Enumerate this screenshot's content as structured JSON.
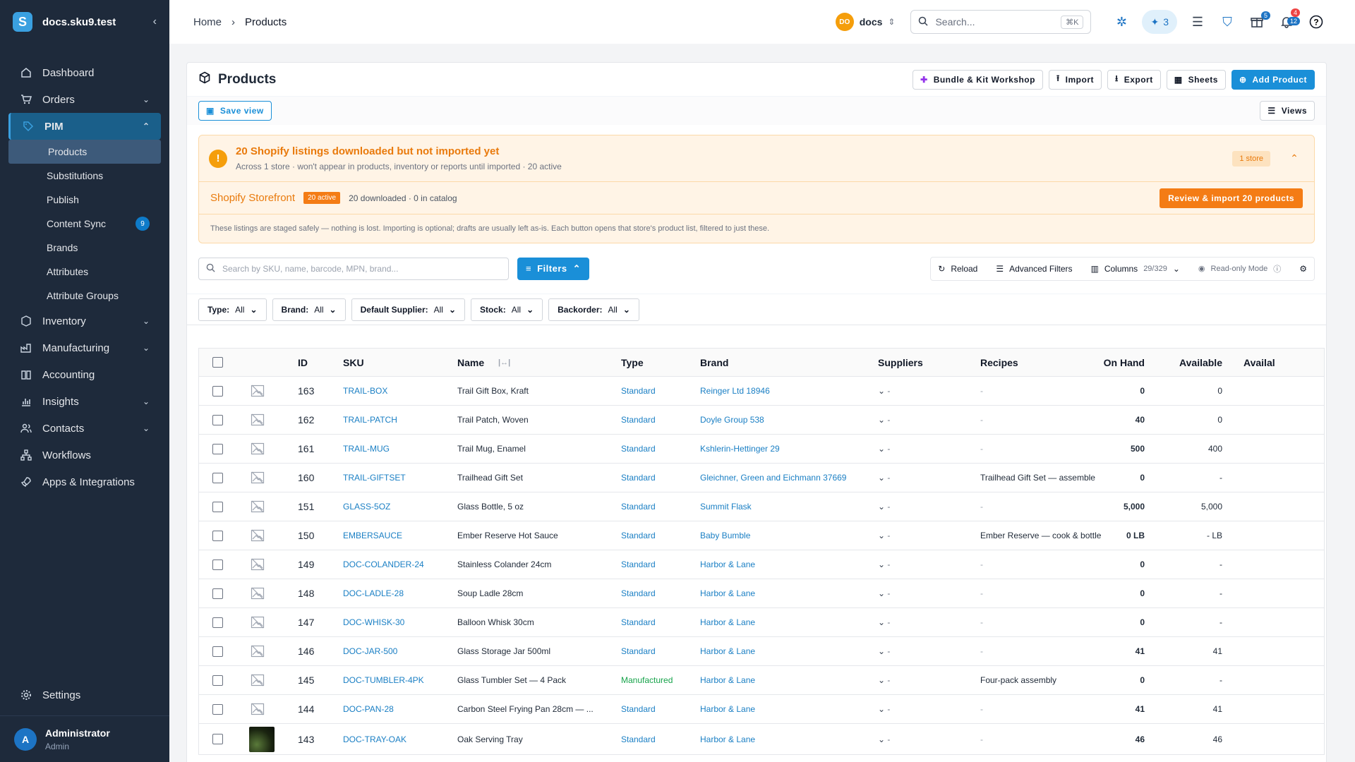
{
  "sidebar": {
    "org": "docs.sku9.test",
    "collapse_icon": "chevron-left",
    "items": [
      {
        "label": "Dashboard",
        "icon": "home-icon"
      },
      {
        "label": "Orders",
        "icon": "cart-icon"
      },
      {
        "label": "PIM",
        "icon": "tag-icon"
      },
      {
        "label": "Inventory",
        "icon": "box-icon"
      },
      {
        "label": "Manufacturing",
        "icon": "factory-icon"
      },
      {
        "label": "Accounting",
        "icon": "book-icon"
      },
      {
        "label": "Insights",
        "icon": "chart-icon"
      },
      {
        "label": "Contacts",
        "icon": "users-icon"
      },
      {
        "label": "Workflows",
        "icon": "workflow-icon"
      },
      {
        "label": "Apps & Integrations",
        "icon": "rocket-icon"
      }
    ],
    "pim_sub": [
      {
        "label": "Products"
      },
      {
        "label": "Substitutions"
      },
      {
        "label": "Publish"
      },
      {
        "label": "Content Sync",
        "badge": "9"
      },
      {
        "label": "Brands"
      },
      {
        "label": "Attributes"
      },
      {
        "label": "Attribute Groups"
      }
    ],
    "settings": "Settings",
    "user": {
      "initial": "A",
      "name": "Administrator",
      "role": "Admin"
    }
  },
  "topbar": {
    "breadcrumb": [
      "Home",
      "Products"
    ],
    "workspace": {
      "badge": "DO",
      "name": "docs"
    },
    "search_placeholder": "Search...",
    "search_kbd": "⌘K",
    "ai_count": "3",
    "gift_badge": "5",
    "bell_badge_top": "4",
    "bell_badge_bottom": "12"
  },
  "page": {
    "title": "Products",
    "actions": {
      "bundle": "Bundle & Kit Workshop",
      "import": "Import",
      "export": "Export",
      "sheets": "Sheets",
      "add": "Add Product"
    },
    "save_view": "Save view",
    "views": "Views"
  },
  "banner": {
    "title": "20 Shopify listings downloaded but not imported yet",
    "subtitle": "Across 1 store · won't appear in products, inventory or reports until imported · 20 active",
    "store_count": "1 store",
    "store_name": "Shopify Storefront",
    "active_tag": "20 active",
    "downloaded": "20 downloaded · 0 in catalog",
    "review_button": "Review & import 20 products",
    "note": "These listings are staged safely — nothing is lost. Importing is optional; drafts are usually left as-is. Each button opens that store's product list, filtered to just these."
  },
  "toolbar": {
    "search_placeholder": "Search by SKU, name, barcode, MPN, brand...",
    "filters": "Filters",
    "reload": "Reload",
    "advanced": "Advanced Filters",
    "columns": "Columns",
    "columns_count": "29/329",
    "readonly": "Read-only Mode"
  },
  "chips": [
    {
      "label": "Type:",
      "value": "All"
    },
    {
      "label": "Brand:",
      "value": "All"
    },
    {
      "label": "Default Supplier:",
      "value": "All"
    },
    {
      "label": "Stock:",
      "value": "All"
    },
    {
      "label": "Backorder:",
      "value": "All"
    }
  ],
  "table": {
    "headers": {
      "id": "ID",
      "sku": "SKU",
      "name": "Name",
      "type": "Type",
      "brand": "Brand",
      "suppliers": "Suppliers",
      "recipes": "Recipes",
      "on_hand": "On Hand",
      "available": "Available",
      "avail2": "Availal"
    },
    "rows": [
      {
        "id": "163",
        "sku": "TRAIL-BOX",
        "name": "Trail Gift Box, Kraft",
        "type": "Standard",
        "brand": "Reinger Ltd 18946",
        "sup": "-",
        "recipe": "-",
        "on_hand": "0",
        "available": "0",
        "img": false
      },
      {
        "id": "162",
        "sku": "TRAIL-PATCH",
        "name": "Trail Patch, Woven",
        "type": "Standard",
        "brand": "Doyle Group 538",
        "sup": "-",
        "recipe": "-",
        "on_hand": "40",
        "available": "0",
        "img": false
      },
      {
        "id": "161",
        "sku": "TRAIL-MUG",
        "name": "Trail Mug, Enamel",
        "type": "Standard",
        "brand": "Kshlerin-Hettinger 29",
        "sup": "-",
        "recipe": "-",
        "on_hand": "500",
        "available": "400",
        "img": false
      },
      {
        "id": "160",
        "sku": "TRAIL-GIFTSET",
        "name": "Trailhead Gift Set",
        "type": "Standard",
        "brand": "Gleichner, Green and Eichmann 37669",
        "sup": "-",
        "recipe": "Trailhead Gift Set — assemble",
        "on_hand": "0",
        "available": "-",
        "img": false
      },
      {
        "id": "151",
        "sku": "GLASS-5OZ",
        "name": "Glass Bottle, 5 oz",
        "type": "Standard",
        "brand": "Summit Flask",
        "sup": "-",
        "recipe": "-",
        "on_hand": "5,000",
        "available": "5,000",
        "img": false
      },
      {
        "id": "150",
        "sku": "EMBERSAUCE",
        "name": "Ember Reserve Hot Sauce",
        "type": "Standard",
        "brand": "Baby Bumble",
        "sup": "-",
        "recipe": "Ember Reserve — cook & bottle",
        "on_hand": "0 LB",
        "available": "- LB",
        "img": false
      },
      {
        "id": "149",
        "sku": "DOC-COLANDER-24",
        "name": "Stainless Colander 24cm",
        "type": "Standard",
        "brand": "Harbor & Lane",
        "sup": "-",
        "recipe": "-",
        "on_hand": "0",
        "available": "-",
        "img": false
      },
      {
        "id": "148",
        "sku": "DOC-LADLE-28",
        "name": "Soup Ladle 28cm",
        "type": "Standard",
        "brand": "Harbor & Lane",
        "sup": "-",
        "recipe": "-",
        "on_hand": "0",
        "available": "-",
        "img": false
      },
      {
        "id": "147",
        "sku": "DOC-WHISK-30",
        "name": "Balloon Whisk 30cm",
        "type": "Standard",
        "brand": "Harbor & Lane",
        "sup": "-",
        "recipe": "-",
        "on_hand": "0",
        "available": "-",
        "img": false
      },
      {
        "id": "146",
        "sku": "DOC-JAR-500",
        "name": "Glass Storage Jar 500ml",
        "type": "Standard",
        "brand": "Harbor & Lane",
        "sup": "-",
        "recipe": "-",
        "on_hand": "41",
        "available": "41",
        "img": false
      },
      {
        "id": "145",
        "sku": "DOC-TUMBLER-4PK",
        "name": "Glass Tumbler Set — 4 Pack",
        "type": "Manufactured",
        "brand": "Harbor & Lane",
        "sup": "-",
        "recipe": "Four-pack assembly",
        "on_hand": "0",
        "available": "-",
        "img": false
      },
      {
        "id": "144",
        "sku": "DOC-PAN-28",
        "name": "Carbon Steel Frying Pan 28cm — ...",
        "type": "Standard",
        "brand": "Harbor & Lane",
        "sup": "-",
        "recipe": "-",
        "on_hand": "41",
        "available": "41",
        "img": false
      },
      {
        "id": "143",
        "sku": "DOC-TRAY-OAK",
        "name": "Oak Serving Tray",
        "type": "Standard",
        "brand": "Harbor & Lane",
        "sup": "-",
        "recipe": "-",
        "on_hand": "46",
        "available": "46",
        "img": true
      }
    ]
  }
}
